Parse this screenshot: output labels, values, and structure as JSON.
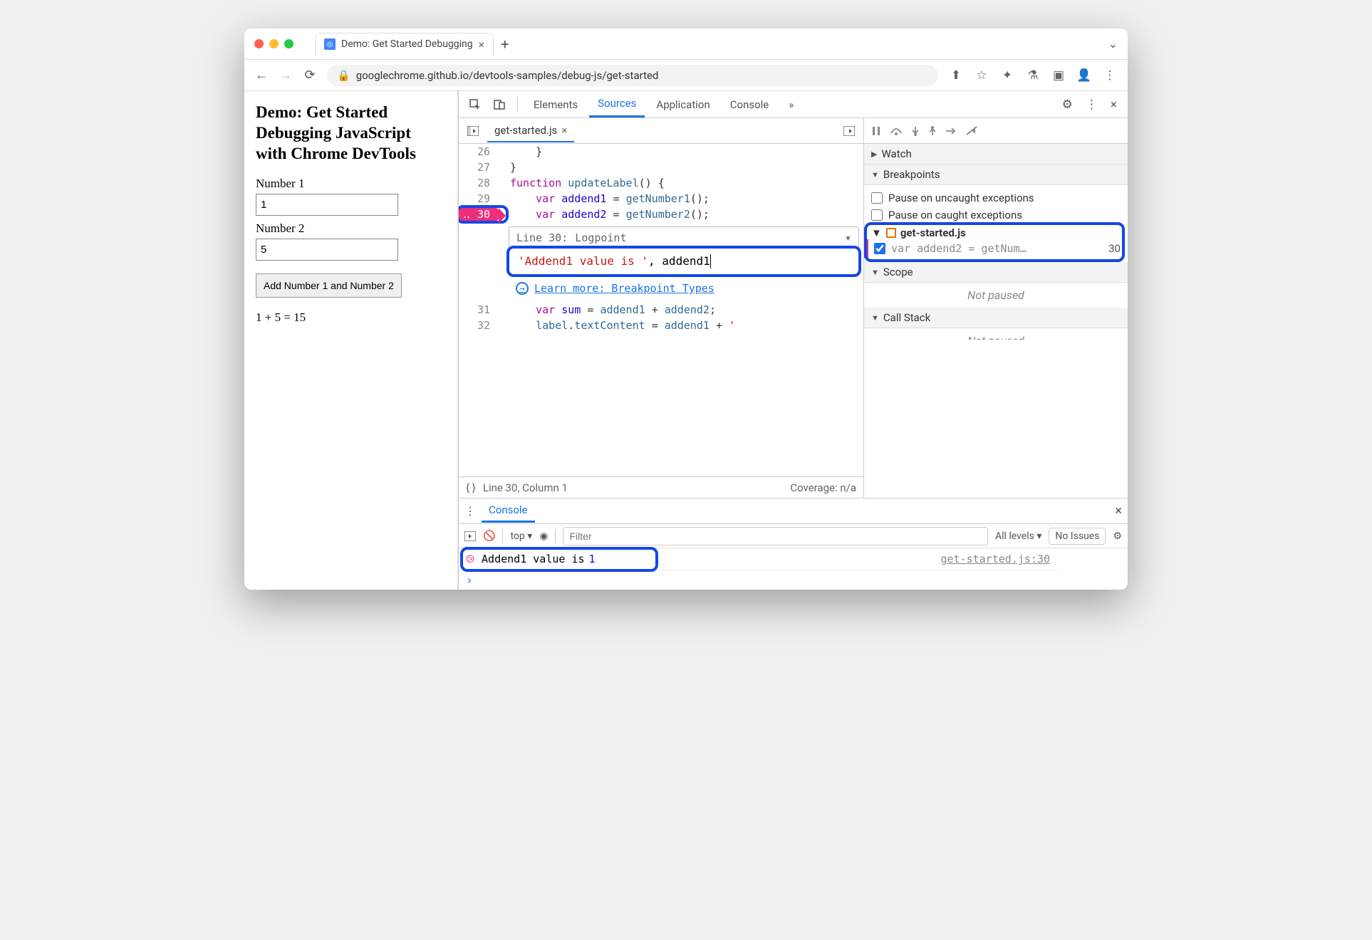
{
  "browser": {
    "tab_title": "Demo: Get Started Debugging",
    "url_display": "googlechrome.github.io/devtools-samples/debug-js/get-started"
  },
  "page": {
    "heading": "Demo: Get Started Debugging JavaScript with Chrome DevTools",
    "label1": "Number 1",
    "value1": "1",
    "label2": "Number 2",
    "value2": "5",
    "button": "Add Number 1 and Number 2",
    "result": "1 + 5 = 15"
  },
  "devtools": {
    "tabs": {
      "elements": "Elements",
      "sources": "Sources",
      "application": "Application",
      "console": "Console"
    },
    "file_tab": "get-started.js",
    "code_lines": [
      {
        "n": 26,
        "text": "  }"
      },
      {
        "n": 27,
        "text": "}"
      },
      {
        "n": 28,
        "text": "function updateLabel() {"
      },
      {
        "n": 29,
        "text": "  var addend1 = getNumber1();"
      },
      {
        "n": 30,
        "text": "  var addend2 = getNumber2();"
      },
      {
        "n": 31,
        "text": "  var sum = addend1 + addend2;"
      },
      {
        "n": 32,
        "text": "  label.textContent = addend1 + ' "
      }
    ],
    "bp_editor": {
      "line_label": "Line 30:",
      "type": "Logpoint",
      "value_str": "'Addend1 value is '",
      "value_ident": ", addend1",
      "learn": "Learn more: Breakpoint Types"
    },
    "status": {
      "pos": "Line 30, Column 1",
      "coverage": "Coverage: n/a"
    },
    "right": {
      "watch": "Watch",
      "breakpoints": "Breakpoints",
      "pause_uncaught": "Pause on uncaught exceptions",
      "pause_caught": "Pause on caught exceptions",
      "bp_file": "get-started.js",
      "bp_entry": "var addend2 = getNum…",
      "bp_line": "30",
      "scope": "Scope",
      "not_paused": "Not paused",
      "callstack": "Call Stack",
      "not_paused2": "Not paused"
    }
  },
  "console": {
    "tab": "Console",
    "context": "top",
    "filter_ph": "Filter",
    "levels": "All levels",
    "issues": "No Issues",
    "msg_text": "Addend1 value is ",
    "msg_val": "1",
    "msg_src": "get-started.js:30"
  }
}
